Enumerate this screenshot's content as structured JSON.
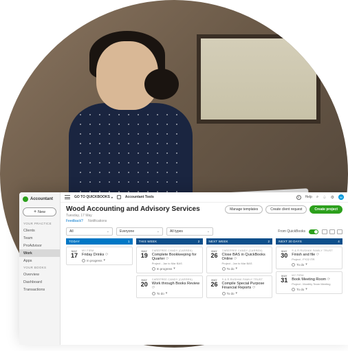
{
  "brand": {
    "name": "Accountant"
  },
  "topbar": {
    "goto": "GO TO QUICKBOOKS",
    "tools": "Accountant Tools",
    "help": "Help",
    "avatar": "M"
  },
  "sidebar": {
    "new": "New",
    "practice_label": "YOUR PRACTICE",
    "practice": [
      "Clients",
      "Team",
      "ProAdvisor",
      "Work",
      "Apps"
    ],
    "books_label": "YOUR BOOKS",
    "books": [
      "Overview",
      "Dashboard",
      "Transactions"
    ],
    "active_index": 3
  },
  "header": {
    "title": "Wood Accounting and Advisory Services",
    "date": "Tuesday, 17 May",
    "tabs": [
      "Feedback?",
      "Notifications"
    ],
    "actions": {
      "manage": "Manage templates",
      "create_request": "Create client request",
      "create_project": "Create project"
    }
  },
  "filters": {
    "f1": "All",
    "f2": "Everyone",
    "f3": "All types",
    "toggle_label": "From QuickBooks"
  },
  "columns": [
    {
      "label": "TODAY",
      "count": "1",
      "cls": "today"
    },
    {
      "label": "THIS WEEK",
      "count": "2",
      "cls": "week"
    },
    {
      "label": "NEXT WEEK",
      "count": "2",
      "cls": "next"
    },
    {
      "label": "NEXT 30 DAYS",
      "count": "4",
      "cls": "month"
    }
  ],
  "cards": {
    "c0": [
      {
        "month": "MAY",
        "day": "17",
        "client": "MY FIRM",
        "title": "Friday Drinks",
        "meta": "",
        "status": "In progress"
      }
    ],
    "c1": [
      {
        "month": "MAY",
        "day": "19",
        "client": "CAREFREE CANDY (CARREN)",
        "title": "Complete Bookkeeping for Quarter",
        "meta": "Project - Jan to Mar BAS",
        "status": "In progress"
      },
      {
        "month": "MAY",
        "day": "20",
        "client": "CAREFREE CANDY (CARREN)",
        "title": "Work through Books Review",
        "meta": "",
        "status": "To do"
      }
    ],
    "c2": [
      {
        "month": "MAY",
        "day": "26",
        "client": "CAREFREE CANDY (CARREN)",
        "title": "Close BAS in QuickBooks Online",
        "meta": "Project - Jan to Mar BAS",
        "status": "To do"
      },
      {
        "month": "MAY",
        "day": "26",
        "client": "S & R RUSHAK FAMILY TRUST",
        "title": "Compile Special Purpose Financial Reports",
        "meta": "",
        "status": "To do"
      }
    ],
    "c3": [
      {
        "month": "MAY",
        "day": "30",
        "client": "S & R RUSHAK FAMILY TRUST",
        "title": "Finish and file",
        "meta": "Project - FY22 ITR",
        "status": "To do"
      },
      {
        "month": "MAY",
        "day": "31",
        "client": "MY FIRM",
        "title": "Book Meeting Room",
        "meta": "Project - Monthly Team Meeting",
        "status": "To do"
      }
    ]
  }
}
